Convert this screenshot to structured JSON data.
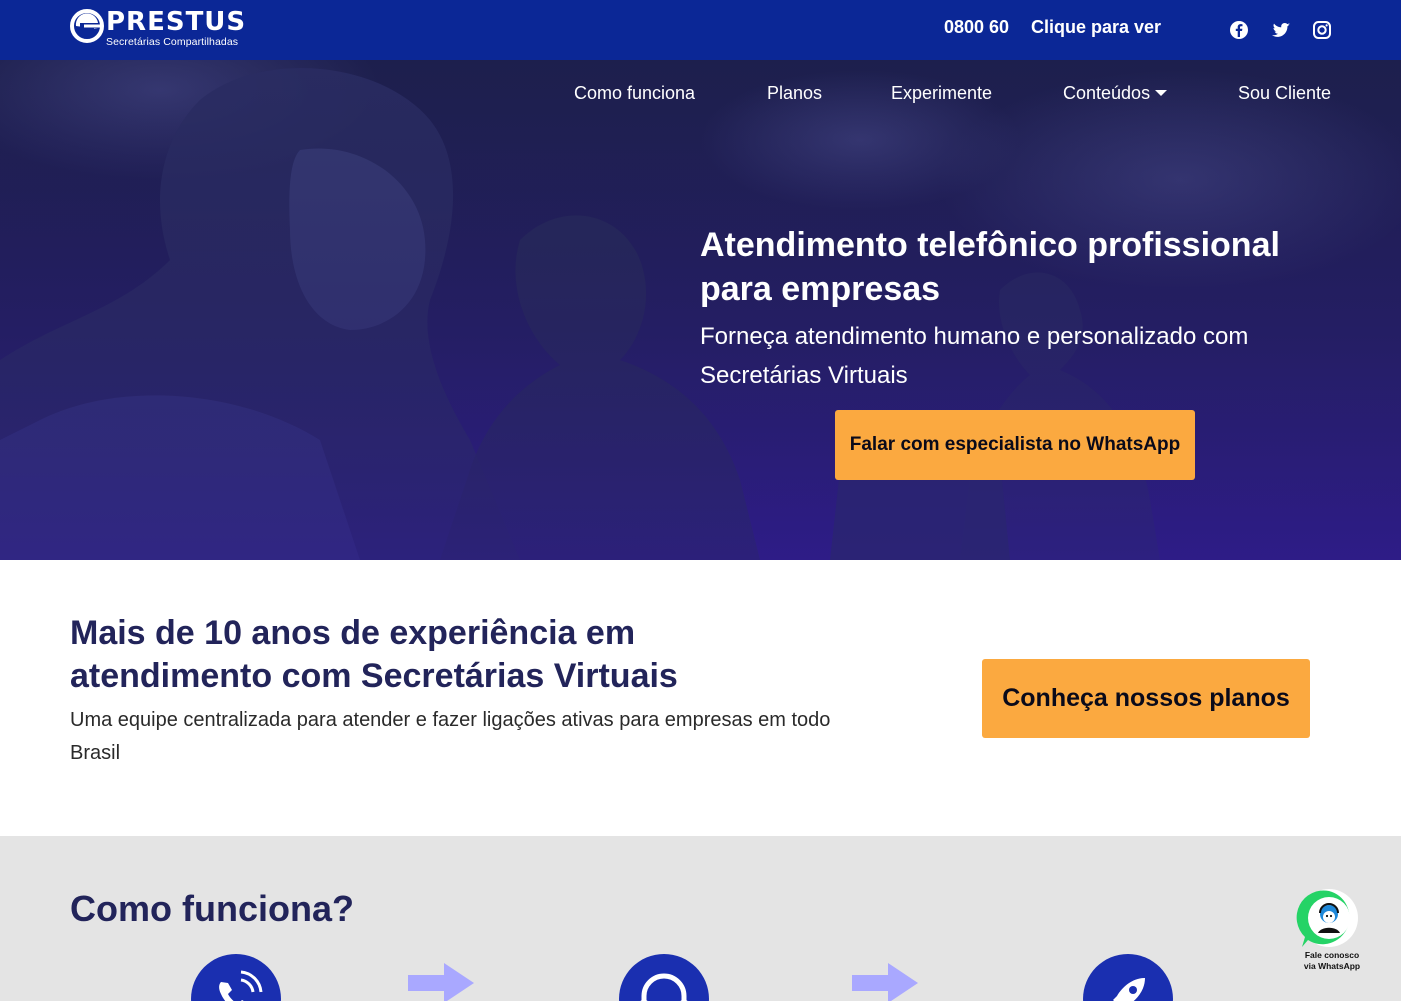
{
  "header": {
    "logo": {
      "name": "PRESTUS",
      "tagline": "Secretárias Compartilhadas"
    },
    "phone": {
      "number": "0800 60",
      "reveal_label": "Clique para ver"
    },
    "social": [
      {
        "icon": "facebook-icon"
      },
      {
        "icon": "twitter-icon"
      },
      {
        "icon": "instagram-icon"
      }
    ]
  },
  "nav": {
    "items": [
      {
        "label": "Como funciona"
      },
      {
        "label": "Planos"
      },
      {
        "label": "Experimente"
      },
      {
        "label": "Conteúdos"
      },
      {
        "label": "Sou Cliente"
      }
    ]
  },
  "hero": {
    "title": "Atendimento telefônico profissional para empresas",
    "subtitle": "Forneça atendimento humano e personalizado com Secretárias Virtuais",
    "cta_label": "Falar com especialista no WhatsApp"
  },
  "experience": {
    "title": "Mais de 10 anos de experiência em atendimento com Secretárias Virtuais",
    "description": "Uma equipe centralizada para atender e fazer ligações ativas para empresas em todo Brasil",
    "cta_label": "Conheça nossos planos"
  },
  "how_it_works": {
    "title": "Como funciona?",
    "steps": [
      {
        "icon": "phone-ringing-icon"
      },
      {
        "icon": "headset-icon"
      },
      {
        "icon": "rocket-icon"
      }
    ]
  },
  "whatsapp_widget": {
    "label_line1": "Fale conosco",
    "label_line2": "via WhatsApp"
  },
  "colors": {
    "topbar": "#0b2796",
    "accent": "#fba940",
    "heading": "#22245a",
    "step_circle": "#1a2fb0",
    "arrow": "#a9a8ff",
    "whatsapp": "#25d366"
  }
}
